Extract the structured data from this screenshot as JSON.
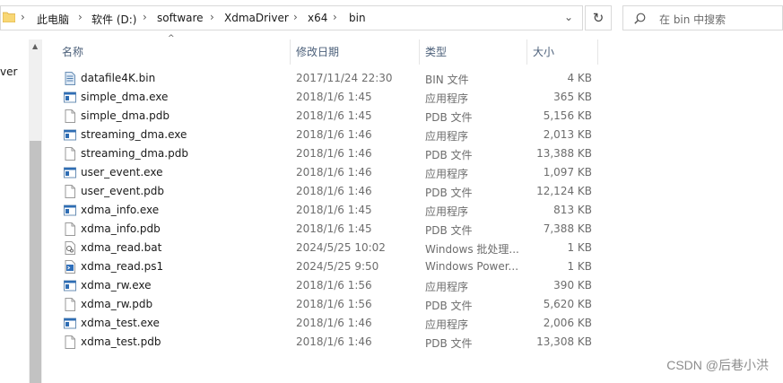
{
  "address": {
    "crumbs": [
      "此电脑",
      "软件 (D:)",
      "software",
      "XdmaDriver",
      "x64",
      "bin"
    ],
    "separator": "›"
  },
  "search": {
    "placeholder": "在 bin 中搜索"
  },
  "nav": {
    "partial_text": "ver"
  },
  "columns": {
    "name": "名称",
    "date": "修改日期",
    "type": "类型",
    "size": "大小"
  },
  "files": [
    {
      "icon": "bin-file-icon",
      "name": "datafile4K.bin",
      "date": "2017/11/24 22:30",
      "type": "BIN 文件",
      "size": "4 KB"
    },
    {
      "icon": "exe-file-icon",
      "name": "simple_dma.exe",
      "date": "2018/1/6 1:45",
      "type": "应用程序",
      "size": "365 KB"
    },
    {
      "icon": "generic-file-icon",
      "name": "simple_dma.pdb",
      "date": "2018/1/6 1:45",
      "type": "PDB 文件",
      "size": "5,156 KB"
    },
    {
      "icon": "exe-file-icon",
      "name": "streaming_dma.exe",
      "date": "2018/1/6 1:46",
      "type": "应用程序",
      "size": "2,013 KB"
    },
    {
      "icon": "generic-file-icon",
      "name": "streaming_dma.pdb",
      "date": "2018/1/6 1:46",
      "type": "PDB 文件",
      "size": "13,388 KB"
    },
    {
      "icon": "exe-file-icon",
      "name": "user_event.exe",
      "date": "2018/1/6 1:46",
      "type": "应用程序",
      "size": "1,097 KB"
    },
    {
      "icon": "generic-file-icon",
      "name": "user_event.pdb",
      "date": "2018/1/6 1:46",
      "type": "PDB 文件",
      "size": "12,124 KB"
    },
    {
      "icon": "exe-file-icon",
      "name": "xdma_info.exe",
      "date": "2018/1/6 1:45",
      "type": "应用程序",
      "size": "813 KB"
    },
    {
      "icon": "generic-file-icon",
      "name": "xdma_info.pdb",
      "date": "2018/1/6 1:45",
      "type": "PDB 文件",
      "size": "7,388 KB"
    },
    {
      "icon": "bat-file-icon",
      "name": "xdma_read.bat",
      "date": "2024/5/25 10:02",
      "type": "Windows 批处理...",
      "size": "1 KB"
    },
    {
      "icon": "ps1-file-icon",
      "name": "xdma_read.ps1",
      "date": "2024/5/25 9:50",
      "type": "Windows Power...",
      "size": "1 KB"
    },
    {
      "icon": "exe-file-icon",
      "name": "xdma_rw.exe",
      "date": "2018/1/6 1:56",
      "type": "应用程序",
      "size": "390 KB"
    },
    {
      "icon": "generic-file-icon",
      "name": "xdma_rw.pdb",
      "date": "2018/1/6 1:56",
      "type": "PDB 文件",
      "size": "5,620 KB"
    },
    {
      "icon": "exe-file-icon",
      "name": "xdma_test.exe",
      "date": "2018/1/6 1:46",
      "type": "应用程序",
      "size": "2,006 KB"
    },
    {
      "icon": "generic-file-icon",
      "name": "xdma_test.pdb",
      "date": "2018/1/6 1:46",
      "type": "PDB 文件",
      "size": "13,308 KB"
    }
  ],
  "watermark": "CSDN @后巷小洪"
}
